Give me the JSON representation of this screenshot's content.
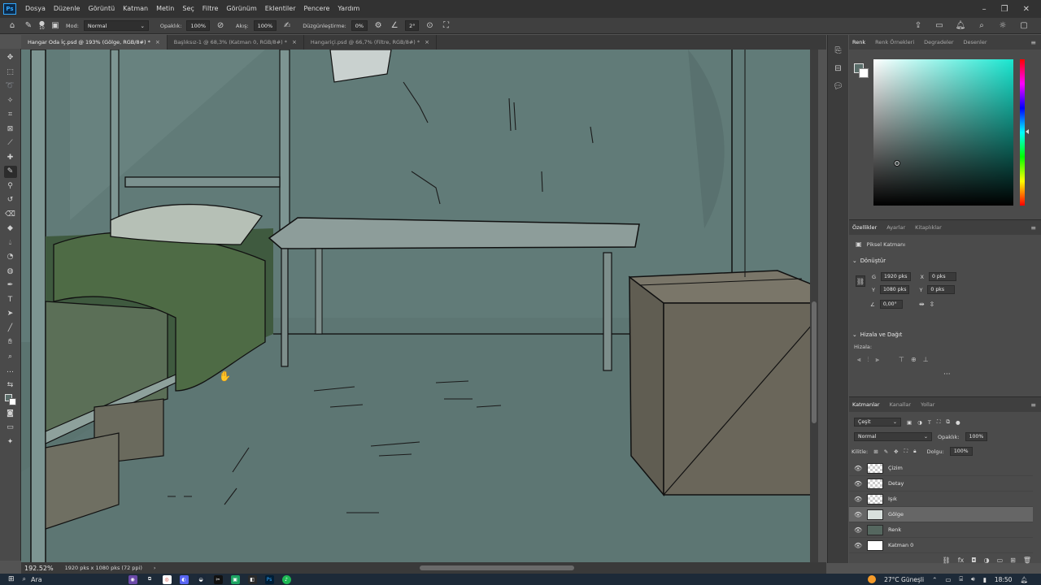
{
  "app": {
    "logo": "Ps"
  },
  "menu": [
    "Dosya",
    "Düzenle",
    "Görüntü",
    "Katman",
    "Metin",
    "Seç",
    "Filtre",
    "Görünüm",
    "Eklentiler",
    "Pencere",
    "Yardım"
  ],
  "options": {
    "brush_size": "10",
    "mode_label": "Mod:",
    "mode_value": "Normal",
    "opacity_label": "Opaklık:",
    "opacity_value": "100%",
    "flow_label": "Akış:",
    "flow_value": "100%",
    "smoothing_label": "Düzgünleştirme:",
    "smoothing_value": "0%",
    "angle_value": "2°"
  },
  "tabs": [
    {
      "label": "Hangar Oda İç.psd @ 193% (Gölge, RGB/8#) *",
      "active": true
    },
    {
      "label": "Başlıksız-1 @ 68,3% (Katman 0, RGB/8#) *",
      "active": false
    },
    {
      "label": "Hangariçi.psd @ 66,7% (Filtre, RGB/8#) *",
      "active": false
    }
  ],
  "status": {
    "zoom": "192.52%",
    "doc_size": "1920 pks x 1080 pks (72 ppi)"
  },
  "color_panel": {
    "tabs": [
      "Renk",
      "Renk Örnekleri",
      "Degradeler",
      "Desenler"
    ],
    "foreground": "#5a6e6a",
    "background": "#ffffff"
  },
  "properties": {
    "tabs": [
      "Özellikler",
      "Ayarlar",
      "Kitaplıklar"
    ],
    "layer_type": "Piksel Katmanı",
    "transform_title": "Dönüştür",
    "w_label": "G",
    "w_value": "1920 pks",
    "h_label": "Y",
    "h_value": "1080 pks",
    "x_label": "X",
    "x_value": "0 pks",
    "y_label": "Y",
    "y_value": "0 pks",
    "angle_value": "0,00°",
    "align_title": "Hizala ve Dağıt",
    "align_label": "Hizala:"
  },
  "layers_panel": {
    "tabs": [
      "Katmanlar",
      "Kanallar",
      "Yollar"
    ],
    "filter_label": "Çeşit",
    "blend_mode": "Normal",
    "opacity_label": "Opaklık:",
    "opacity_value": "100%",
    "lock_label": "Kilitle:",
    "fill_label": "Dolgu:",
    "fill_value": "100%",
    "layers": [
      {
        "name": "Çizim",
        "thumb": "checker",
        "active": false
      },
      {
        "name": "Detay",
        "thumb": "checker",
        "active": false
      },
      {
        "name": "Işık",
        "thumb": "checker",
        "active": false
      },
      {
        "name": "Gölge",
        "thumb": "sketch",
        "active": true
      },
      {
        "name": "Renk",
        "thumb": "green",
        "active": false
      },
      {
        "name": "Katman 0",
        "thumb": "white",
        "active": false
      }
    ]
  },
  "taskbar": {
    "search": "Ara",
    "weather": "27°C Güneşli",
    "time": "18:50"
  }
}
